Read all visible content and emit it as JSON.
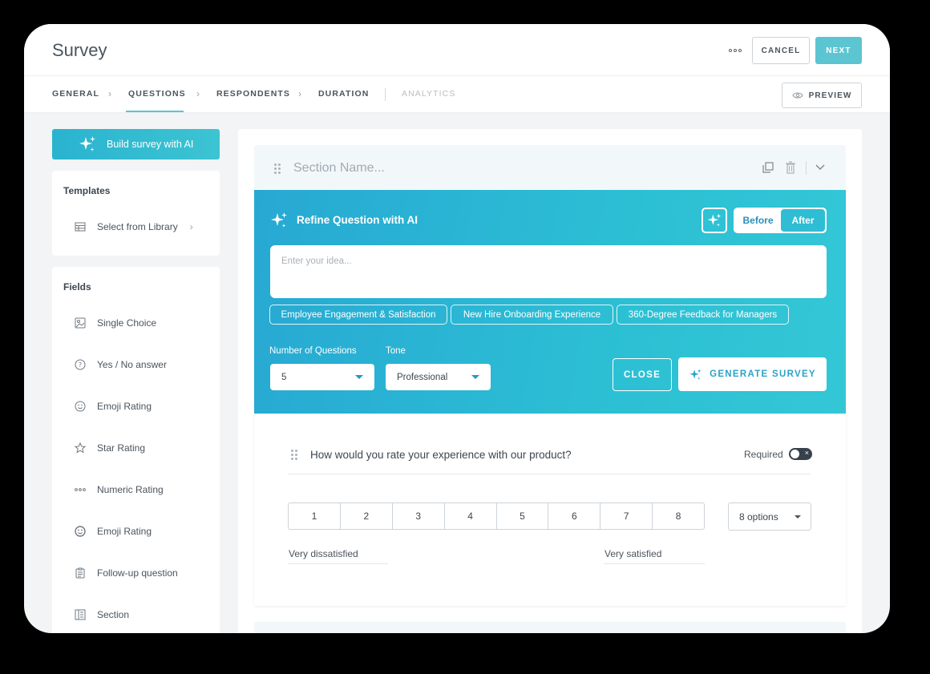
{
  "header": {
    "title": "Survey",
    "cancel_label": "CANCEL",
    "next_label": "NEXT"
  },
  "nav": {
    "items": [
      {
        "label": "GENERAL"
      },
      {
        "label": "QUESTIONS"
      },
      {
        "label": "RESPONDENTS"
      },
      {
        "label": "DURATION"
      },
      {
        "label": "ANALYTICS"
      }
    ],
    "preview_label": "PREVIEW"
  },
  "sidebar": {
    "ai_button_label": "Build survey with AI",
    "templates_title": "Templates",
    "templates_item": "Select from Library",
    "fields_title": "Fields",
    "fields": [
      {
        "label": "Single Choice"
      },
      {
        "label": "Yes / No answer"
      },
      {
        "label": "Emoji Rating"
      },
      {
        "label": "Star Rating"
      },
      {
        "label": "Numeric Rating"
      },
      {
        "label": "Emoji Rating"
      },
      {
        "label": "Follow-up question"
      },
      {
        "label": "Section"
      }
    ]
  },
  "section": {
    "name_placeholder": "Section Name..."
  },
  "ai_panel": {
    "title": "Refine Question with AI",
    "toggle_before": "Before",
    "toggle_after": "After",
    "idea_placeholder": "Enter your idea...",
    "chips": [
      "Employee Engagement & Satisfaction",
      "New Hire Onboarding Experience",
      "360-Degree Feedback for Managers"
    ],
    "num_questions_label": "Number of Questions",
    "num_questions_value": "5",
    "tone_label": "Tone",
    "tone_value": "Professional",
    "close_label": "CLOSE",
    "generate_label": "GENERATE SURVEY"
  },
  "question": {
    "text": "How would you rate your experience with our product?",
    "required_label": "Required",
    "scale": [
      "1",
      "2",
      "3",
      "4",
      "5",
      "6",
      "7",
      "8"
    ],
    "options_value": "8 options",
    "min_label": "Very dissatisfied",
    "max_label": "Very satisfied"
  }
}
